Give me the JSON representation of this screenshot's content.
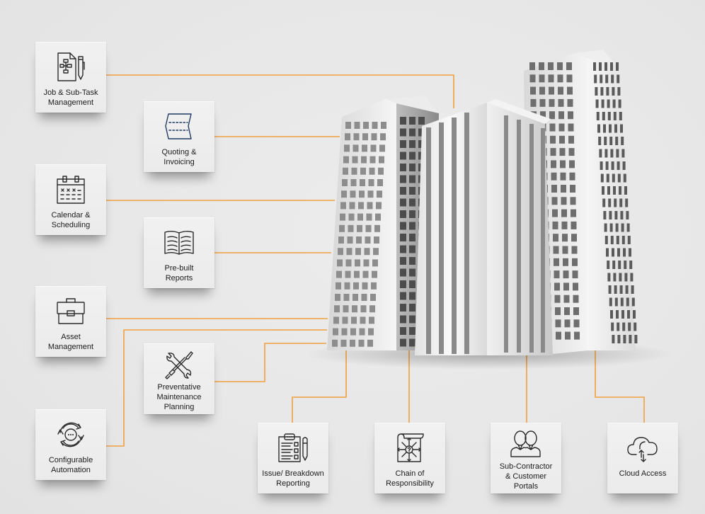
{
  "diagram": {
    "title": "",
    "center_image": "office-buildings",
    "connector_color": "#f0a040",
    "features": [
      {
        "id": "job",
        "label": "Job & Sub-Task\nManagement",
        "icon": "document-flowchart-pen-icon"
      },
      {
        "id": "quoting",
        "label": "Quoting &\nInvoicing",
        "icon": "folded-paper-icon",
        "icon_color": "#1f3a64"
      },
      {
        "id": "calendar",
        "label": "Calendar &\nScheduling",
        "icon": "calendar-icon"
      },
      {
        "id": "reports",
        "label": "Pre-built\nReports",
        "icon": "open-book-icon"
      },
      {
        "id": "asset",
        "label": "Asset\nManagement",
        "icon": "briefcase-icon"
      },
      {
        "id": "maintenance",
        "label": "Preventative\nMaintenance\nPlanning",
        "icon": "wrench-screwdriver-icon"
      },
      {
        "id": "automation",
        "label": "Configurable\nAutomation",
        "icon": "cycle-arrows-icon"
      },
      {
        "id": "issue",
        "label": "Issue/ Breakdown\nReporting",
        "icon": "clipboard-checklist-pen-icon"
      },
      {
        "id": "chain",
        "label": "Chain of\nResponsibility",
        "icon": "scroll-arrows-question-icon"
      },
      {
        "id": "portals",
        "label": "Sub-Contractor\n& Customer\nPortals",
        "icon": "people-icon"
      },
      {
        "id": "cloud",
        "label": "Cloud Access",
        "icon": "cloud-sync-icon"
      }
    ]
  }
}
